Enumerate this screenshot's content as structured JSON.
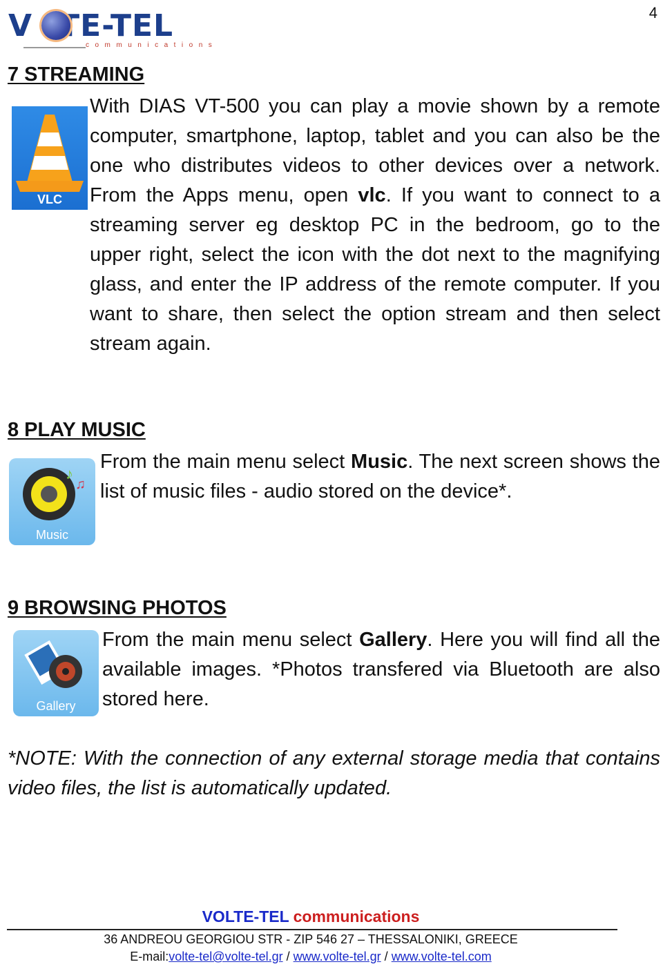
{
  "header": {
    "logo_text": "V  LTE-TEL",
    "logo_subtitle": "communications",
    "page_number": "4"
  },
  "sections": [
    {
      "heading": "7 STREAMING",
      "icon": {
        "name": "vlc-icon",
        "label": "VLC"
      },
      "text_before_bold": "With DIAS VT-500 you can play a movie shown by a remote computer, smartphone, laptop, tablet and you can also be the one who distributes videos to other devices over a network. From the Apps menu, open ",
      "bold": "vlc",
      "text_after_bold": ". If you want to connect to a streaming server eg desktop PC in the bedroom, go to the upper right, select the icon with the dot next to the magnifying glass, and enter the IP address of the remote computer. If you want to share, then select the option stream and then select stream again."
    },
    {
      "heading": "8 PLAY MUSIC",
      "icon": {
        "name": "music-icon",
        "label": "Music"
      },
      "text_before_bold": "From the main menu select ",
      "bold": "Music",
      "text_after_bold": ". The next screen shows the list of music files - audio stored on the device*."
    },
    {
      "heading": "9 BROWSING PHOTOS",
      "icon": {
        "name": "gallery-icon",
        "label": "Gallery"
      },
      "text_before_bold": "From the main menu select ",
      "bold": "Gallery",
      "text_after_bold": ". Here you will find all the available images. *Photos transfered via Bluetooth are also stored here."
    }
  ],
  "note": "*NOTE: With the connection of any external storage media that contains video files, the list is automatically updated.",
  "footer": {
    "brand_blue": "VOLTE-TEL",
    "brand_red": "communications",
    "address": "36 ANDREOU GEORGIOU STR - ZIP 546 27 – THESSALONIKI, GREECE",
    "email_label": "E-mail:",
    "email": "volte-tel@volte-tel.gr",
    "separator": " / ",
    "website_gr": "www.volte-tel.gr",
    "website_com": "www.volte-tel.com",
    "colors": {
      "blue": "#1a2ac9",
      "red": "#cc1f1f"
    }
  }
}
